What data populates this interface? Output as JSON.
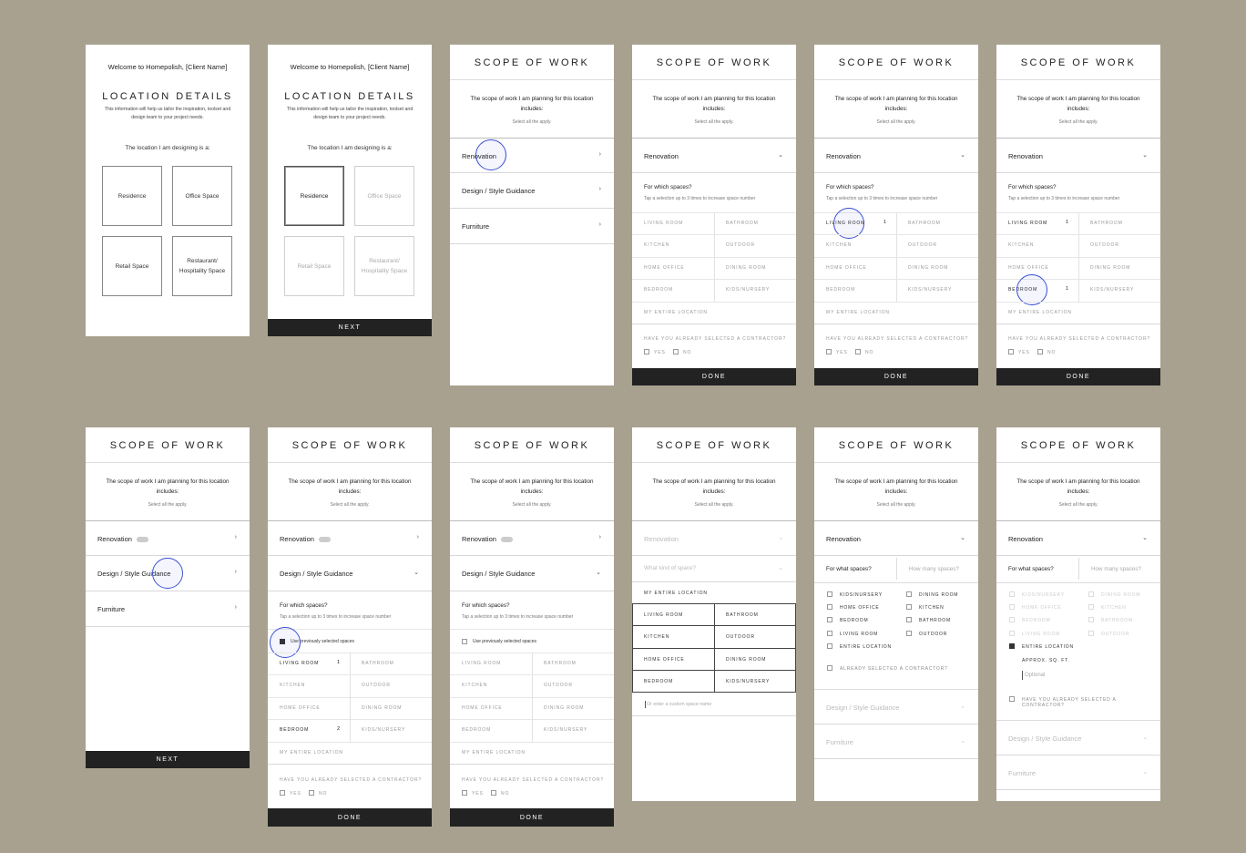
{
  "location": {
    "welcome": "Welcome to Homepolish, [Client Name]",
    "title": "LOCATION DETAILS",
    "subtitle": "This information will help us tailor the inspiration, toolset and design team to your project needs.",
    "question": "The location I am designing is a:",
    "options": [
      "Residence",
      "Office Space",
      "Retail Space",
      "Restaurant/ Hospitality Space"
    ],
    "next": "NEXT"
  },
  "scope": {
    "title": "SCOPE OF WORK",
    "intro": "The scope of work I am planning for this location includes:",
    "hint": "Select all the apply.",
    "renovation": "Renovation",
    "design": "Design / Style Guidance",
    "furniture": "Furniture",
    "for_which": "For which spaces?",
    "tap_hint": "Tap a selection up to 3 times to increase space number",
    "spaces_left": [
      "LIVING ROOM",
      "KITCHEN",
      "HOME OFFICE",
      "BEDROOM"
    ],
    "spaces_right": [
      "BATHROOM",
      "OUTDOOR",
      "DINING ROOM",
      "KIDS/NURSERY"
    ],
    "entire": "MY ENTIRE LOCATION",
    "contractor_q": "HAVE YOU ALREADY SELECTED A CONTRACTOR?",
    "yes": "YES",
    "no": "NO",
    "done": "DONE",
    "next": "NEXT",
    "count_one": "1",
    "count_two": "2",
    "use_previous": "Use previously selected spaces",
    "what_kind": "What kind of space?",
    "custom_placeholder": "Or enter a custom space name",
    "for_what": "For what spaces?",
    "how_many": "How many spaces?",
    "list_left": [
      "KIDS/NURSERY",
      "HOME OFFICE",
      "BEDROOM",
      "LIVING ROOM",
      "ENTIRE LOCATION"
    ],
    "list_right": [
      "DINING ROOM",
      "KITCHEN",
      "BATHROOM",
      "OUTDOOR"
    ],
    "already_selected": "ALREADY SELECTED A CONTRACTOR?",
    "approx": "APPROX. SQ. FT.",
    "optional": "Optional",
    "have_selected": "HAVE YOU ALREADY SELECTED A CONTRACTOR?"
  },
  "colors": {
    "background": "#a8a18f",
    "bar": "#222222",
    "tap_indicator": "#3a4fd0"
  }
}
